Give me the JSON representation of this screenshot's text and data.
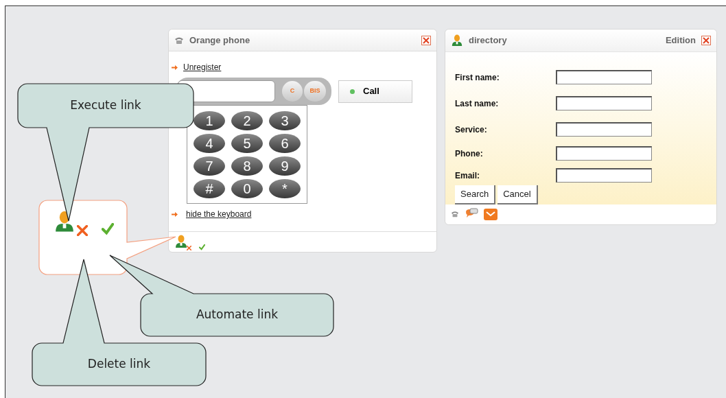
{
  "phone": {
    "title": "Orange phone",
    "links": [
      "Unregister",
      "hide the keyboard"
    ],
    "clear": "C",
    "redial": "BIS",
    "call": "Call",
    "keys": [
      "1",
      "2",
      "3",
      "4",
      "5",
      "6",
      "7",
      "8",
      "9",
      "#",
      "0",
      "*"
    ]
  },
  "directory": {
    "title": "directory",
    "mode": "Edition",
    "fields": [
      {
        "label": "First name:"
      },
      {
        "label": "Last name:"
      },
      {
        "label": "Service:"
      },
      {
        "label": "Phone:"
      },
      {
        "label": "Email:"
      }
    ],
    "buttons": [
      "Search",
      "Cancel"
    ]
  },
  "callouts": [
    {
      "text": "Execute link"
    },
    {
      "text": "Automate link"
    },
    {
      "text": "Delete link"
    }
  ]
}
